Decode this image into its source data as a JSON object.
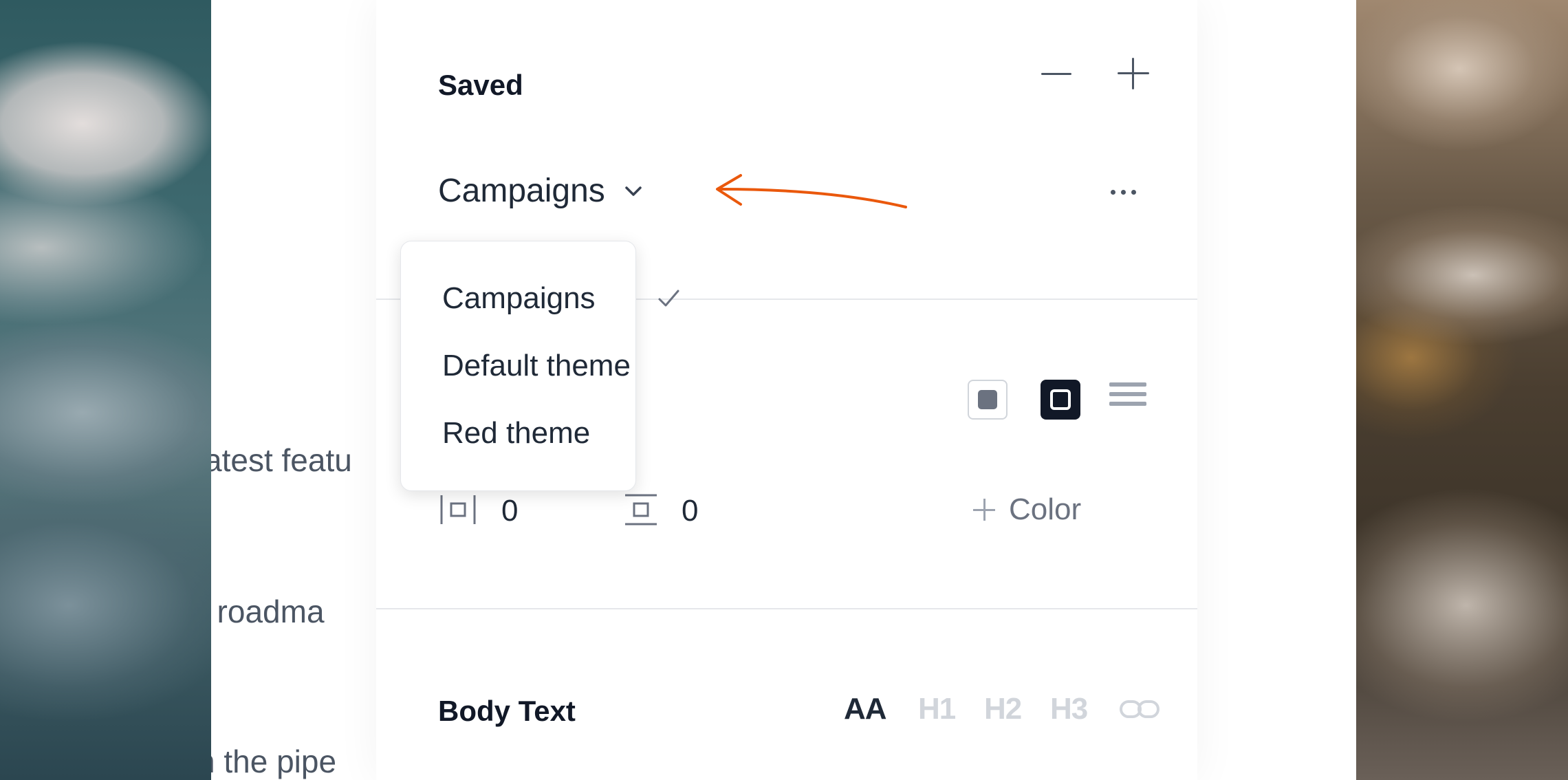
{
  "saved": {
    "title": "Saved",
    "selected": "Campaigns",
    "menu_items": [
      "Campaigns",
      "Default theme",
      "Red theme"
    ]
  },
  "padding": {
    "horizontal_value": "0",
    "vertical_value": "0"
  },
  "add_color_label": "Color",
  "body_text": {
    "title": "Body Text",
    "format_buttons": [
      "AA",
      "H1",
      "H2",
      "H3"
    ]
  },
  "background_text": {
    "line1": "atest featu",
    "line2": "ct roadma",
    "line3": "n the pipe"
  },
  "colors": {
    "annotation_arrow": "#ea580c",
    "dark_style": "#111827",
    "muted": "#9ca3af"
  },
  "icons": [
    "minus-icon",
    "plus-icon",
    "chevron-down-icon",
    "more-icon",
    "check-icon",
    "fill-style-icon",
    "outline-style-icon",
    "lines-style-icon",
    "horizontal-padding-icon",
    "vertical-padding-icon",
    "link-icon"
  ]
}
